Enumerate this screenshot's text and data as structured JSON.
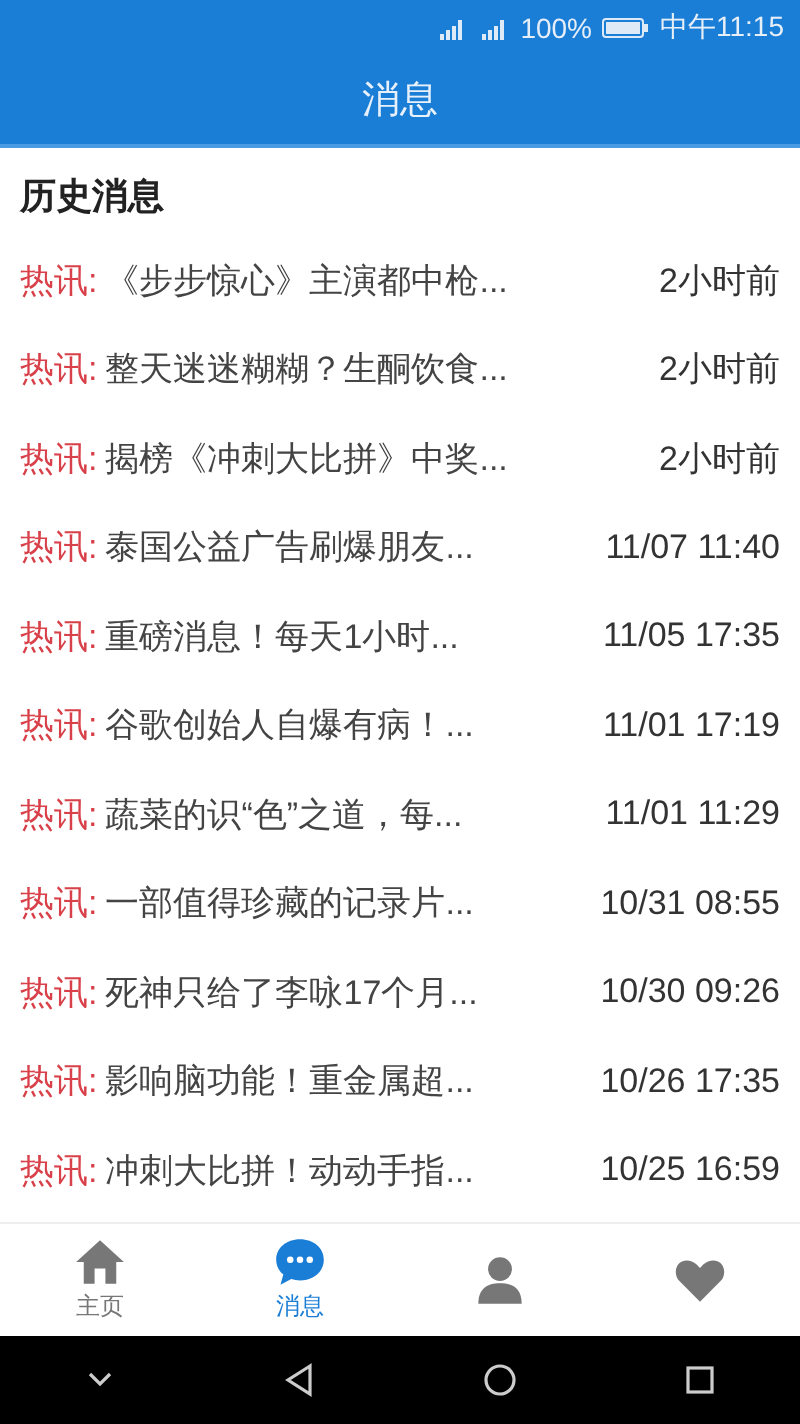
{
  "status_bar": {
    "battery": "100%",
    "time": "中午11:15"
  },
  "header": {
    "title": "消息"
  },
  "section_title": "历史消息",
  "messages": [
    {
      "tag": "热讯:",
      "title": "《步步惊心》主演都中枪...",
      "time": "2小时前"
    },
    {
      "tag": "热讯:",
      "title": "整天迷迷糊糊？生酮饮食...",
      "time": "2小时前"
    },
    {
      "tag": "热讯:",
      "title": "揭榜《冲刺大比拼》中奖...",
      "time": "2小时前"
    },
    {
      "tag": "热讯:",
      "title": "泰国公益广告刷爆朋友...",
      "time": "11/07 11:40"
    },
    {
      "tag": "热讯:",
      "title": "重磅消息！每天1小时...",
      "time": "11/05 17:35"
    },
    {
      "tag": "热讯:",
      "title": "谷歌创始人自爆有病！...",
      "time": "11/01 17:19"
    },
    {
      "tag": "热讯:",
      "title": "蔬菜的识“色”之道，每...",
      "time": "11/01 11:29"
    },
    {
      "tag": "热讯:",
      "title": "一部值得珍藏的记录片...",
      "time": "10/31 08:55"
    },
    {
      "tag": "热讯:",
      "title": "死神只给了李咏17个月...",
      "time": "10/30 09:26"
    },
    {
      "tag": "热讯:",
      "title": "影响脑功能！重金属超...",
      "time": "10/26 17:35"
    },
    {
      "tag": "热讯:",
      "title": "冲刺大比拼！动动手指...",
      "time": "10/25 16:59"
    }
  ],
  "nav": [
    {
      "kind": "home",
      "label": "主页",
      "selected": false
    },
    {
      "kind": "chat",
      "label": "消息",
      "selected": true
    },
    {
      "kind": "person",
      "selected": false
    },
    {
      "kind": "heart",
      "selected": false
    }
  ]
}
